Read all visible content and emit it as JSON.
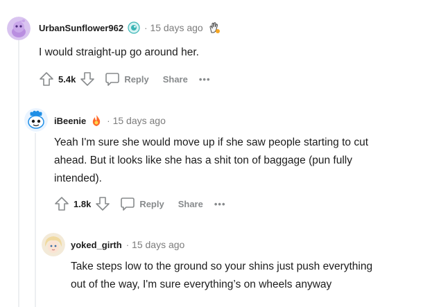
{
  "comments": [
    {
      "username": "UrbanSunflower962",
      "time": "15 days ago",
      "body": "I would straight-up go around her.",
      "votes": "5.4k",
      "reply_label": "Reply",
      "share_label": "Share",
      "more_label": "•••",
      "avatar_icon": "reddit-snoo-avatar-purple",
      "flair_icons": [
        "helper-award-icon",
        "hand-award-icon"
      ]
    },
    {
      "username": "iBeenie",
      "time": "15 days ago",
      "body_lines": [
        "Yeah I'm sure she would move up if she saw people starting to cut",
        "ahead. But it looks like she has a shit ton of baggage (pun fully",
        "intended)."
      ],
      "votes": "1.8k",
      "reply_label": "Reply",
      "share_label": "Share",
      "more_label": "•••",
      "avatar_icon": "reddit-snoo-avatar-blue",
      "flair_icons": [
        "fire-award-icon"
      ]
    },
    {
      "username": "yoked_girth",
      "time": "15 days ago",
      "body_lines": [
        "Take steps low to the ground so your shins just push everything",
        "out of the way, I'm sure everything’s on wheels anyway"
      ],
      "avatar_icon": "anime-avatar"
    }
  ],
  "colors": {
    "text": "#1c1c1c",
    "meta": "#7c7c7c",
    "action": "#878a8c",
    "thread_line": "#edeff1"
  }
}
